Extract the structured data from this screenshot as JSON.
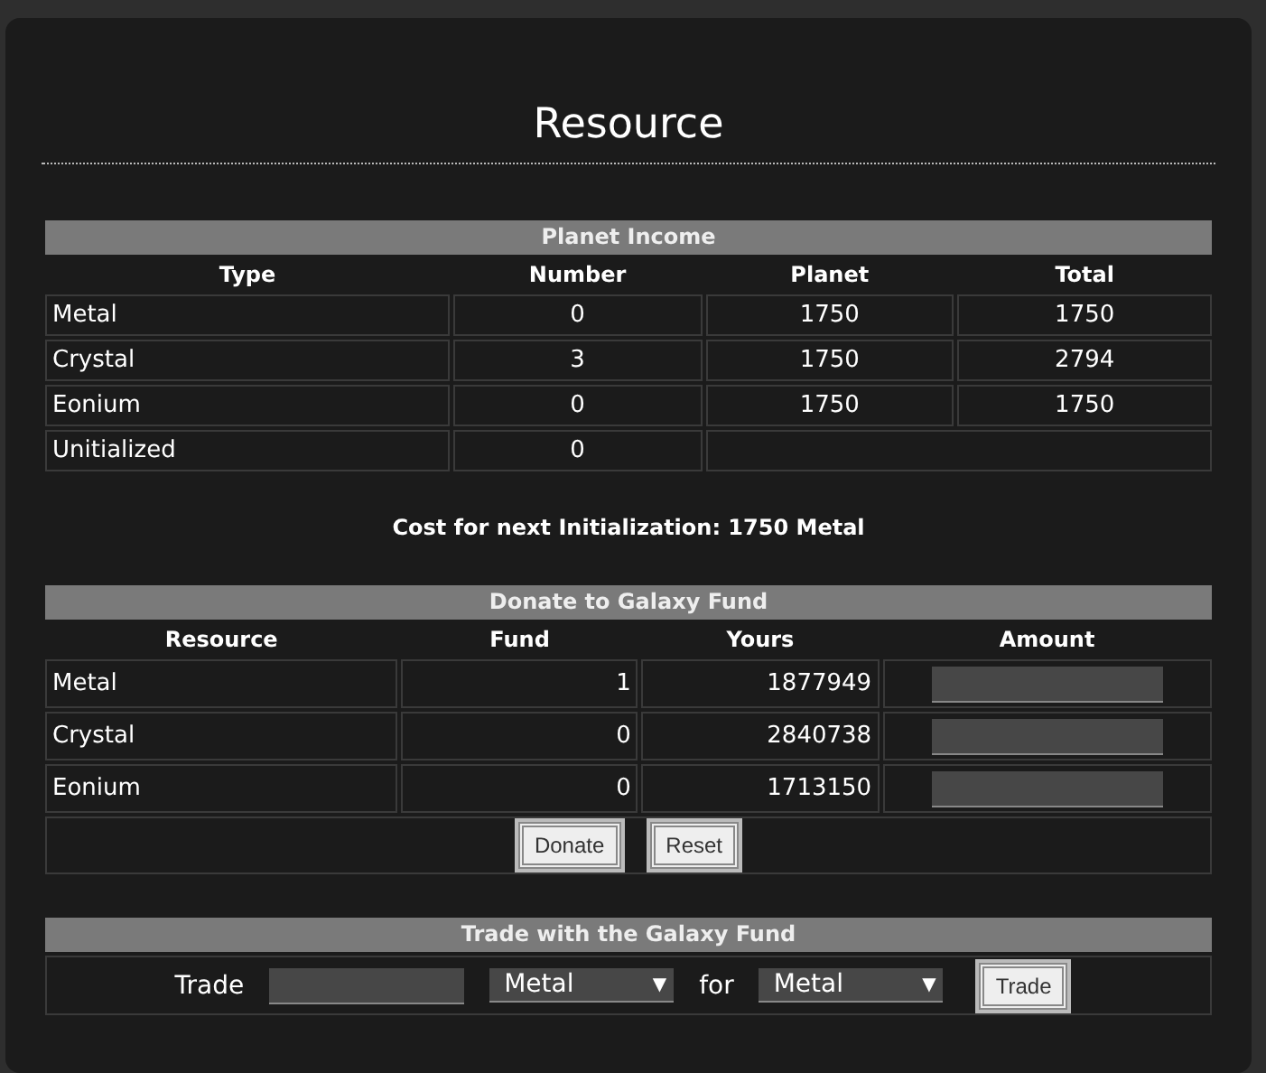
{
  "title": "Resource",
  "planet_income": {
    "heading": "Planet Income",
    "columns": [
      "Type",
      "Number",
      "Planet",
      "Total"
    ],
    "rows": [
      [
        "Metal",
        "0",
        "1750",
        "1750"
      ],
      [
        "Crystal",
        "3",
        "1750",
        "2794"
      ],
      [
        "Eonium",
        "0",
        "1750",
        "1750"
      ],
      [
        "Unitialized",
        "0"
      ]
    ]
  },
  "cost_note": "Cost for next Initialization: 1750 Metal",
  "donate": {
    "heading": "Donate to Galaxy Fund",
    "columns": [
      "Resource",
      "Fund",
      "Yours",
      "Amount"
    ],
    "rows": [
      {
        "resource": "Metal",
        "fund": "1",
        "yours": "1877949"
      },
      {
        "resource": "Crystal",
        "fund": "0",
        "yours": "2840738"
      },
      {
        "resource": "Eonium",
        "fund": "0",
        "yours": "1713150"
      }
    ],
    "buttons": [
      "Donate",
      "Reset"
    ]
  },
  "trade": {
    "heading": "Trade with the Galaxy Fund",
    "label": "Trade",
    "from": "Metal",
    "joiner": "for",
    "to": "Metal",
    "arrow": "▼",
    "button": "Trade"
  }
}
